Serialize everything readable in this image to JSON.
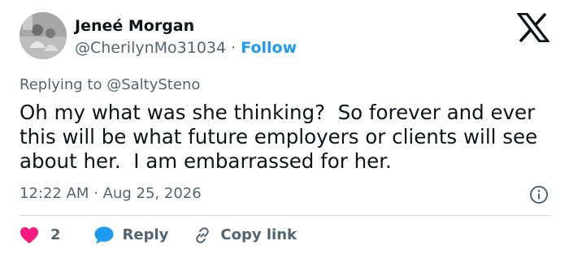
{
  "author": {
    "name": "Jeneé Morgan",
    "handle": "@CherilynMo31034",
    "separator": "·",
    "follow_label": "Follow"
  },
  "replying_to": {
    "prefix": "Replying to",
    "mention": "@SaltySteno"
  },
  "tweet": {
    "text": "Oh my what was she thinking?  So forever and ever this will be what future employers or clients will see about her.  I am embarrassed for her.",
    "time": "12:22 AM",
    "date_separator": "·",
    "date": "Aug 25, 2026"
  },
  "actions": {
    "like_count": "2",
    "reply_label": "Reply",
    "copy_link_label": "Copy link"
  },
  "colors": {
    "like": "#f91880",
    "reply": "#1d9bf0",
    "follow": "#1d9bf0",
    "secondary_text": "#536471"
  },
  "icons": {
    "logo": "x-logo-icon",
    "info": "info-icon",
    "like": "heart-icon",
    "reply": "speech-bubble-icon",
    "copy_link": "link-icon"
  }
}
